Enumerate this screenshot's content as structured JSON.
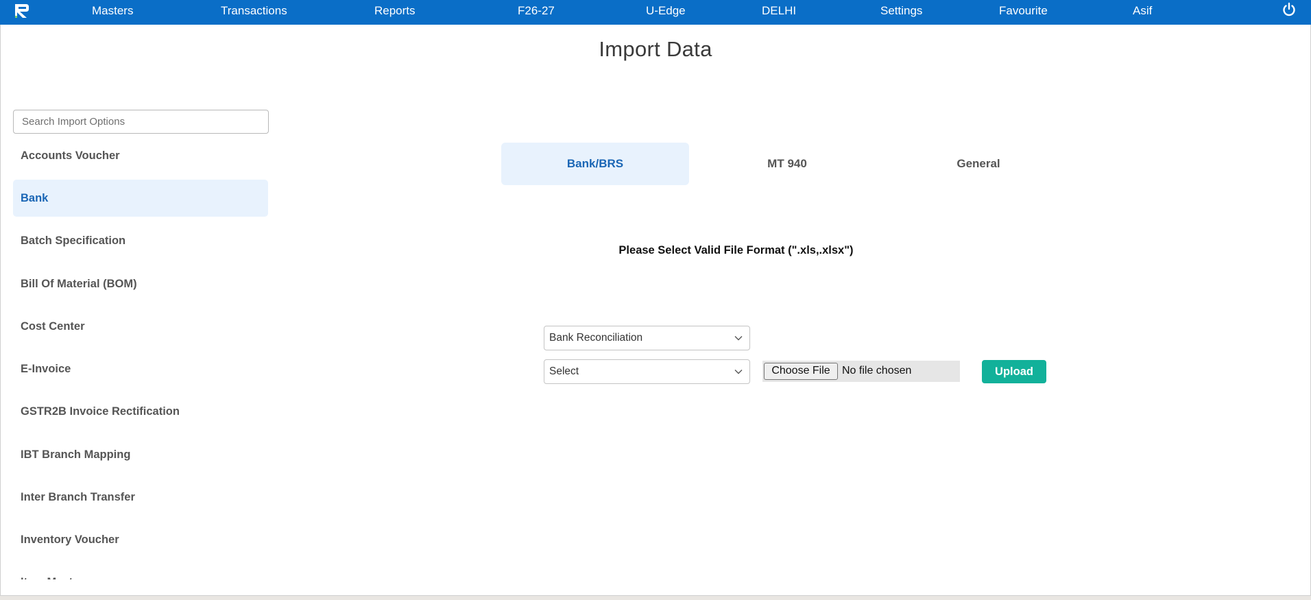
{
  "nav": {
    "items": [
      "Masters",
      "Transactions",
      "Reports",
      "F26-27",
      "U-Edge",
      "DELHI",
      "Settings",
      "Favourite",
      "Asif"
    ]
  },
  "page": {
    "title": "Import Data"
  },
  "sidebar": {
    "search_placeholder": "Search Import Options",
    "items": [
      {
        "label": "Accounts Voucher",
        "active": false
      },
      {
        "label": "Bank",
        "active": true
      },
      {
        "label": "Batch Specification",
        "active": false
      },
      {
        "label": "Bill Of Material (BOM)",
        "active": false
      },
      {
        "label": "Cost Center",
        "active": false
      },
      {
        "label": "E-Invoice",
        "active": false
      },
      {
        "label": "GSTR2B Invoice Rectification",
        "active": false
      },
      {
        "label": "IBT Branch Mapping",
        "active": false
      },
      {
        "label": "Inter Branch Transfer",
        "active": false
      },
      {
        "label": "Inventory Voucher",
        "active": false
      },
      {
        "label": "Item Master",
        "active": false
      }
    ]
  },
  "tabs": [
    {
      "label": "Bank/BRS",
      "active": true
    },
    {
      "label": "MT 940",
      "active": false
    },
    {
      "label": "General",
      "active": false
    }
  ],
  "form": {
    "notice": "Please Select Valid File Format (\".xls,.xlsx\")",
    "type_select": "Bank Reconciliation",
    "bank_select": "Select",
    "choose_file_label": "Choose File",
    "no_file_text": "No file chosen",
    "upload_label": "Upload"
  },
  "colors": {
    "nav_bg": "#0a6ec7",
    "active_bg": "#e8f2fd",
    "active_text": "#1a66b5",
    "upload_bg": "#12b19a"
  },
  "icons": {
    "logo": "app-logo-icon",
    "power": "power-icon",
    "chevron": "chevron-down-icon"
  }
}
